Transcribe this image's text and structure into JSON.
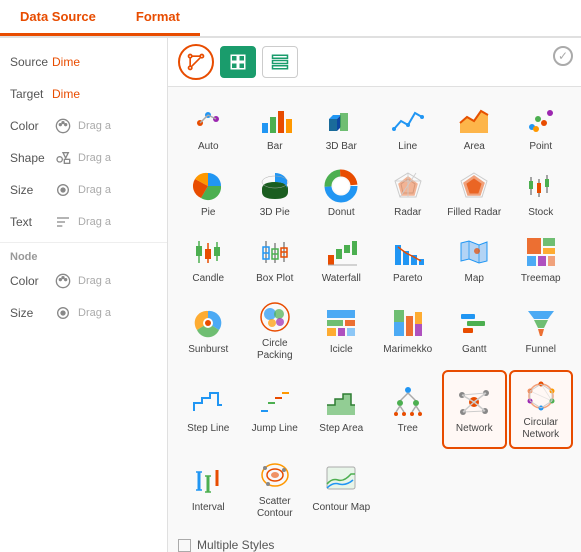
{
  "tabs": [
    {
      "id": "data-source",
      "label": "Data Source",
      "active": false
    },
    {
      "id": "format",
      "label": "Format",
      "active": true
    }
  ],
  "left_panel": {
    "fields": [
      {
        "label": "Source",
        "value": "Dime",
        "type": "value"
      },
      {
        "label": "Target",
        "value": "Dime",
        "type": "value"
      },
      {
        "label": "Color",
        "value": "Drag a",
        "type": "drag",
        "icon": "palette"
      },
      {
        "label": "Shape",
        "value": "Drag a",
        "type": "drag",
        "icon": "shape"
      },
      {
        "label": "Size",
        "value": "Drag a",
        "type": "drag",
        "icon": "size"
      },
      {
        "label": "Text",
        "value": "Drag a",
        "type": "drag",
        "icon": "text"
      }
    ],
    "node_section": "Node",
    "node_fields": [
      {
        "label": "Color",
        "value": "Drag a",
        "type": "drag",
        "icon": "palette"
      },
      {
        "label": "Size",
        "value": "Drag a",
        "type": "drag",
        "icon": "size"
      }
    ]
  },
  "chart_types": [
    {
      "id": "auto",
      "label": "Auto",
      "icon": "auto"
    },
    {
      "id": "bar",
      "label": "Bar",
      "icon": "bar"
    },
    {
      "id": "3d-bar",
      "label": "3D Bar",
      "icon": "3dbar"
    },
    {
      "id": "line",
      "label": "Line",
      "icon": "line"
    },
    {
      "id": "area",
      "label": "Area",
      "icon": "area"
    },
    {
      "id": "point",
      "label": "Point",
      "icon": "point"
    },
    {
      "id": "pie",
      "label": "Pie",
      "icon": "pie"
    },
    {
      "id": "3d-pie",
      "label": "3D Pie",
      "icon": "3dpie"
    },
    {
      "id": "donut",
      "label": "Donut",
      "icon": "donut"
    },
    {
      "id": "radar",
      "label": "Radar",
      "icon": "radar"
    },
    {
      "id": "filled-radar",
      "label": "Filled Radar",
      "icon": "filled-radar"
    },
    {
      "id": "stock",
      "label": "Stock",
      "icon": "stock"
    },
    {
      "id": "candle",
      "label": "Candle",
      "icon": "candle"
    },
    {
      "id": "box-plot",
      "label": "Box Plot",
      "icon": "box-plot"
    },
    {
      "id": "waterfall",
      "label": "Waterfall",
      "icon": "waterfall"
    },
    {
      "id": "pareto",
      "label": "Pareto",
      "icon": "pareto"
    },
    {
      "id": "map",
      "label": "Map",
      "icon": "map"
    },
    {
      "id": "treemap",
      "label": "Treemap",
      "icon": "treemap"
    },
    {
      "id": "sunburst",
      "label": "Sunburst",
      "icon": "sunburst"
    },
    {
      "id": "circle-packing",
      "label": "Circle Packing",
      "icon": "circle-packing"
    },
    {
      "id": "icicle",
      "label": "Icicle",
      "icon": "icicle"
    },
    {
      "id": "marimekko",
      "label": "Marimekko",
      "icon": "marimekko"
    },
    {
      "id": "gantt",
      "label": "Gantt",
      "icon": "gantt"
    },
    {
      "id": "funnel",
      "label": "Funnel",
      "icon": "funnel"
    },
    {
      "id": "step-line",
      "label": "Step Line",
      "icon": "step-line"
    },
    {
      "id": "jump-line",
      "label": "Jump Line",
      "icon": "jump-line"
    },
    {
      "id": "step-area",
      "label": "Step Area",
      "icon": "step-area"
    },
    {
      "id": "tree",
      "label": "Tree",
      "icon": "tree"
    },
    {
      "id": "network",
      "label": "Network",
      "icon": "network",
      "selected": true
    },
    {
      "id": "circular-network",
      "label": "Circular Network",
      "icon": "circular-network",
      "selected": true
    },
    {
      "id": "interval",
      "label": "Interval",
      "icon": "interval"
    },
    {
      "id": "scatter-contour",
      "label": "Scatter Contour",
      "icon": "scatter-contour"
    },
    {
      "id": "contour-map",
      "label": "Contour Map",
      "icon": "contour-map"
    }
  ],
  "multiple_styles_label": "Multiple Styles",
  "colors": {
    "orange": "#e84c00",
    "green": "#1a9c6c",
    "blue": "#2196f3",
    "teal": "#009688",
    "purple": "#9c27b0",
    "gray": "#9e9e9e"
  }
}
